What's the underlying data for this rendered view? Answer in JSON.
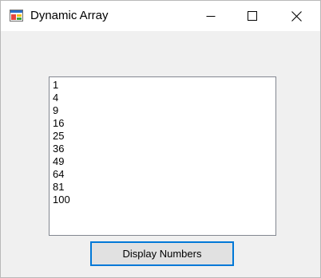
{
  "window": {
    "title": "Dynamic Array",
    "app_icon": "winforms-app-icon",
    "controls": {
      "minimize_icon": "minimize-icon",
      "maximize_icon": "maximize-icon",
      "close_icon": "close-icon"
    }
  },
  "listbox": {
    "items": [
      "1",
      "4",
      "9",
      "16",
      "25",
      "36",
      "49",
      "64",
      "81",
      "100"
    ]
  },
  "buttons": {
    "display_label": "Display Numbers"
  },
  "colors": {
    "focus_border": "#0078d7",
    "button_face": "#e1e1e1",
    "window_bg": "#f0f0f0"
  }
}
